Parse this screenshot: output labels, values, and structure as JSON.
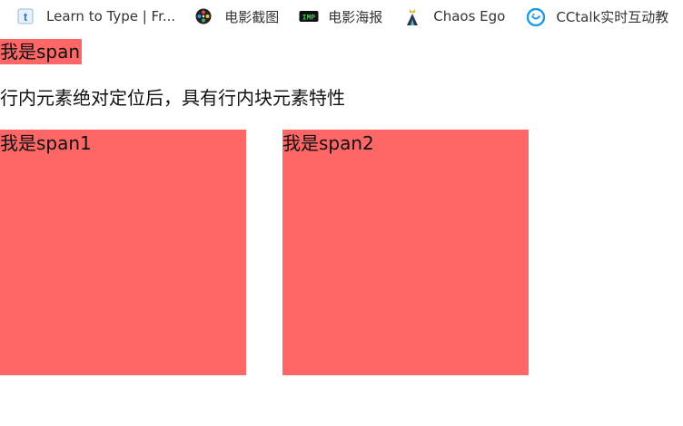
{
  "bookmarks_bar": {
    "items": [
      {
        "label": "Learn to Type | Fr...",
        "icon": "typing-t-icon"
      },
      {
        "label": "电影截图",
        "icon": "film-reel-icon"
      },
      {
        "label": "电影海报",
        "icon": "imp-poster-icon"
      },
      {
        "label": "Chaos Ego",
        "icon": "chaos-ego-icon"
      },
      {
        "label": "CCtalk实时互动教",
        "icon": "cctalk-icon"
      }
    ]
  },
  "content": {
    "span_text": "我是span",
    "info_text": "行内元素绝对定位后，具有行内块元素特性",
    "span1_text": "我是span1",
    "span2_text": "我是span2"
  },
  "colors": {
    "box_background": "#ff6666",
    "text": "#111111"
  }
}
